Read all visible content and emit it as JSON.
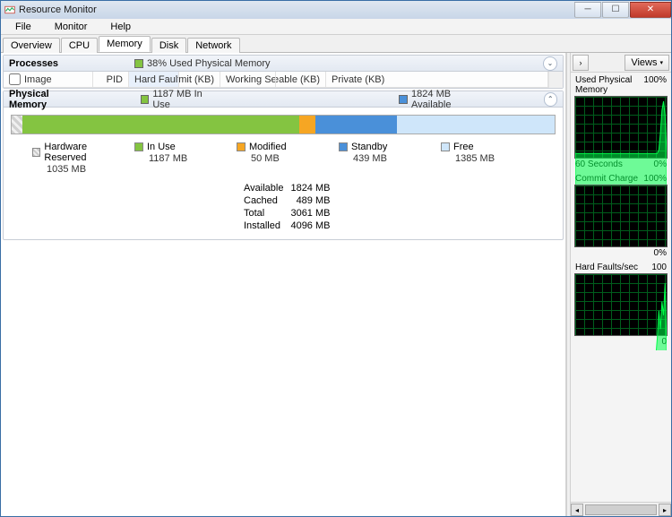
{
  "window": {
    "title": "Resource Monitor"
  },
  "menu": {
    "file": "File",
    "monitor": "Monitor",
    "help": "Help"
  },
  "tabs": {
    "overview": "Overview",
    "cpu": "CPU",
    "memory": "Memory",
    "disk": "Disk",
    "network": "Network"
  },
  "processes": {
    "title": "Processes",
    "summary": "38% Used Physical Memory",
    "cols": {
      "image": "Image",
      "pid": "PID",
      "hard_faults": "Hard Faults...",
      "commit": "Commit (KB)",
      "working_set": "Working Set (K...",
      "shareable": "Shareable (KB)",
      "private": "Private (KB)"
    }
  },
  "physmem": {
    "title": "Physical Memory",
    "left": "1187 MB In Use",
    "right": "1824 MB Available",
    "legend": {
      "hw": {
        "label": "Hardware Reserved",
        "value": "1035 MB"
      },
      "inuse": {
        "label": "In Use",
        "value": "1187 MB"
      },
      "modified": {
        "label": "Modified",
        "value": "50 MB"
      },
      "standby": {
        "label": "Standby",
        "value": "439 MB"
      },
      "free": {
        "label": "Free",
        "value": "1385 MB"
      }
    },
    "stats": {
      "available_l": "Available",
      "available_v": "1824 MB",
      "cached_l": "Cached",
      "cached_v": "489 MB",
      "total_l": "Total",
      "total_v": "3061 MB",
      "installed_l": "Installed",
      "installed_v": "4096 MB"
    }
  },
  "side": {
    "views": "Views",
    "charts": {
      "c1": {
        "title": "Used Physical Memory",
        "max": "100%",
        "foot_l": "60 Seconds",
        "foot_r": "0%"
      },
      "c2": {
        "title": "Commit Charge",
        "max": "100%",
        "foot_r": "0%"
      },
      "c3": {
        "title": "Hard Faults/sec",
        "max": "100",
        "foot_r": "0"
      }
    }
  },
  "chart_data": [
    {
      "type": "area",
      "title": "Used Physical Memory",
      "ylim": [
        0,
        100
      ],
      "xrange_seconds": 60,
      "values": [
        38,
        38,
        38,
        38,
        38,
        38,
        38,
        38,
        38,
        38,
        38,
        38,
        38,
        38,
        38,
        38,
        38,
        38,
        38,
        38,
        38,
        38,
        38,
        38,
        38,
        38,
        38,
        38,
        38,
        38,
        38,
        38,
        38,
        38,
        38,
        38,
        38,
        38,
        38,
        38,
        38,
        38,
        38,
        38,
        38,
        38,
        38,
        38,
        38,
        38,
        38,
        38,
        38,
        38,
        42,
        60,
        85,
        95,
        80,
        38
      ]
    },
    {
      "type": "area",
      "title": "Commit Charge",
      "ylim": [
        0,
        100
      ],
      "xrange_seconds": 60,
      "values": [
        0,
        0,
        0,
        0,
        0,
        0,
        0,
        0,
        0,
        0,
        0,
        0,
        0,
        0,
        0,
        0,
        0,
        0,
        0,
        0,
        0,
        0,
        0,
        0,
        0,
        0,
        0,
        0,
        0,
        0,
        0,
        0,
        0,
        0,
        0,
        0,
        0,
        0,
        0,
        0,
        0,
        0,
        0,
        0,
        0,
        0,
        0,
        0,
        0,
        0,
        0,
        0,
        0,
        0,
        0,
        0,
        0,
        0,
        0,
        0
      ]
    },
    {
      "type": "area",
      "title": "Hard Faults/sec",
      "ylim": [
        0,
        100
      ],
      "xrange_seconds": 60,
      "values": [
        0,
        0,
        0,
        0,
        0,
        0,
        0,
        0,
        0,
        0,
        0,
        0,
        0,
        0,
        0,
        0,
        0,
        0,
        0,
        0,
        0,
        0,
        0,
        0,
        0,
        0,
        0,
        0,
        0,
        0,
        0,
        0,
        0,
        0,
        0,
        0,
        0,
        0,
        0,
        0,
        0,
        0,
        0,
        0,
        0,
        0,
        0,
        0,
        0,
        0,
        0,
        0,
        10,
        30,
        60,
        40,
        70,
        55,
        90,
        20
      ]
    }
  ]
}
